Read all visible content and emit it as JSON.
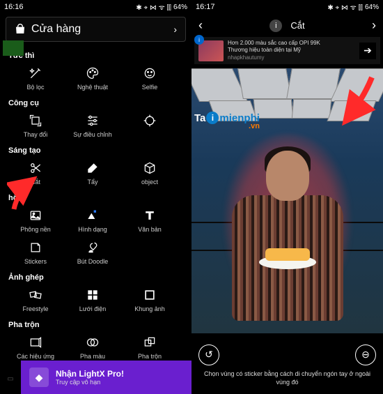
{
  "status": {
    "time_left": "16:16",
    "time_right": "16:17",
    "battery": "64%",
    "indicators": "✱ ⌖ ⋈ ᯤ ⫿⫿"
  },
  "left": {
    "shop": {
      "label": "Cửa hàng",
      "icon": "bag-icon"
    },
    "sections": [
      {
        "title": "Tức thì",
        "items": [
          {
            "name": "wand-icon",
            "label": "Bộ lọc"
          },
          {
            "name": "palette-icon",
            "label": "Nghệ thuật"
          },
          {
            "name": "face-icon",
            "label": "Selfie"
          }
        ]
      },
      {
        "title": "Công cụ",
        "items": [
          {
            "name": "transform-icon",
            "label": "Thay đổi"
          },
          {
            "name": "sliders-icon",
            "label": "Sự điều chỉnh"
          },
          {
            "name": "target-icon",
            "label": ""
          }
        ]
      },
      {
        "title": "Sáng tạo",
        "items": [
          {
            "name": "scissors-icon",
            "label": "Cắt"
          },
          {
            "name": "eraser-icon",
            "label": "Tẩy"
          },
          {
            "name": "cube-icon",
            "label": "object"
          }
        ]
      },
      {
        "title": "hội",
        "items": [
          {
            "name": "image-icon",
            "label": "Phông nền"
          },
          {
            "name": "shapes-icon",
            "label": "Hình dạng"
          },
          {
            "name": "text-icon",
            "label": "Văn bản"
          }
        ]
      },
      {
        "title": "",
        "items": [
          {
            "name": "sticker-icon",
            "label": "Stickers"
          },
          {
            "name": "brush-icon",
            "label": "Bút Doodle"
          }
        ]
      },
      {
        "title": "Ảnh ghép",
        "items": [
          {
            "name": "freestyle-icon",
            "label": "Freestyle"
          },
          {
            "name": "grid-icon",
            "label": "Lưới điện"
          },
          {
            "name": "frame-icon",
            "label": "Khung ảnh"
          }
        ]
      },
      {
        "title": "Pha trộn",
        "items": [
          {
            "name": "effects-icon",
            "label": "Các hiệu ứng"
          },
          {
            "name": "blend-icon",
            "label": "Pha màu"
          },
          {
            "name": "merge-icon",
            "label": "Pha trộn"
          }
        ]
      }
    ],
    "pro": {
      "title": "Nhận LightX Pro!",
      "sub": "Truy cập vô hạn"
    }
  },
  "right": {
    "title": "Cắt",
    "ad": {
      "line1": "Hơn 2.000 màu sắc cao cấp OPI 99K",
      "line2": "Thương hiệu toàn diện tại Mỹ",
      "line3": "nhapkhautumy"
    },
    "watermark": {
      "ta": "Ta",
      "i": "i",
      "rest": "mienphi",
      "vn": ".vn"
    },
    "hint": "Chọn vùng có sticker bằng cách di chuyển ngón tay ở ngoài vùng đó"
  }
}
